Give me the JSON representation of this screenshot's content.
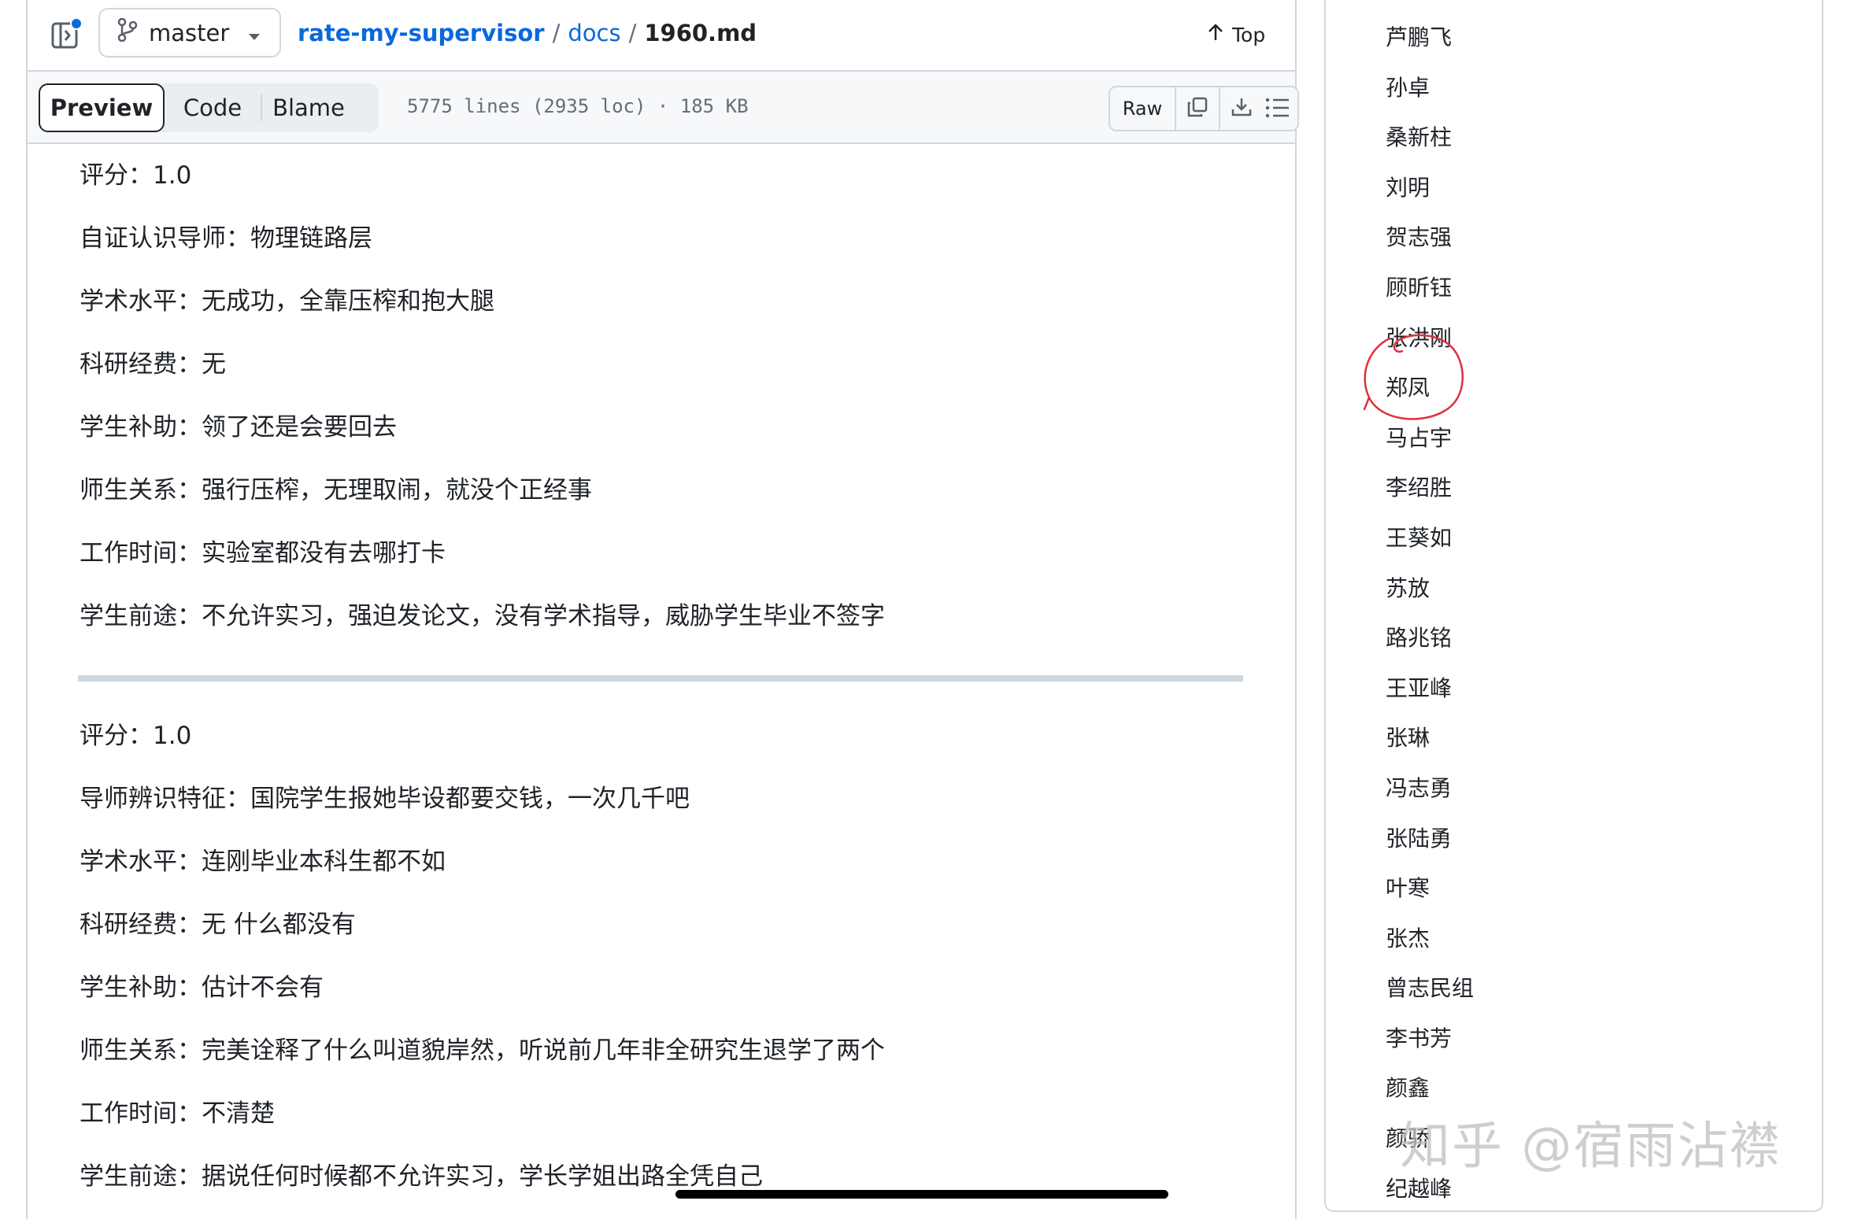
{
  "header": {
    "branch": "master",
    "breadcrumb": {
      "repo": "rate-my-supervisor",
      "sep1": "/",
      "folder": "docs",
      "sep2": "/",
      "file": "1960.md"
    },
    "top_label": "Top"
  },
  "toolbar": {
    "tabs": [
      "Preview",
      "Code",
      "Blame"
    ],
    "file_info": "5775 lines (2935 loc) · 185 KB",
    "raw_label": "Raw"
  },
  "content": {
    "entries": [
      {
        "lines": [
          "评分：1.0",
          "自证认识导师：物理链路层",
          "学术水平：无成功，全靠压榨和抱大腿",
          "科研经费：无",
          "学生补助：领了还是会要回去",
          "师生关系：强行压榨，无理取闹，就没个正经事",
          "工作时间：实验室都没有去哪打卡",
          "学生前途：不允许实习，强迫发论文，没有学术指导，威胁学生毕业不签字"
        ]
      },
      {
        "lines": [
          "评分：1.0",
          "导师辨识特征：国院学生报她毕设都要交钱，一次几千吧",
          "学术水平：连刚毕业本科生都不如",
          "科研经费：无 什么都没有",
          "学生补助：估计不会有",
          "师生关系：完美诠释了什么叫道貌岸然，听说前几年非全研究生退学了两个",
          "工作时间：不清楚",
          "学生前途：据说任何时候都不允许实习，学长学姐出路全凭自己"
        ]
      }
    ]
  },
  "sidebar": {
    "names": [
      "芦鹏飞",
      "孙卓",
      "桑新柱",
      "刘明",
      "贺志强",
      "顾昕钰",
      "张洪刚",
      "郑凤",
      "马占宇",
      "李绍胜",
      "王葵如",
      "苏放",
      "路兆铭",
      "王亚峰",
      "张琳",
      "冯志勇",
      "张陆勇",
      "叶寒",
      "张杰",
      "曾志民组",
      "李书芳",
      "颜鑫",
      "颜骄",
      "纪越峰"
    ]
  },
  "watermark": "知乎 @宿雨沾襟",
  "colors": {
    "link": "#0969da",
    "border": "#d0d7de",
    "annotation": "#e0303a"
  }
}
